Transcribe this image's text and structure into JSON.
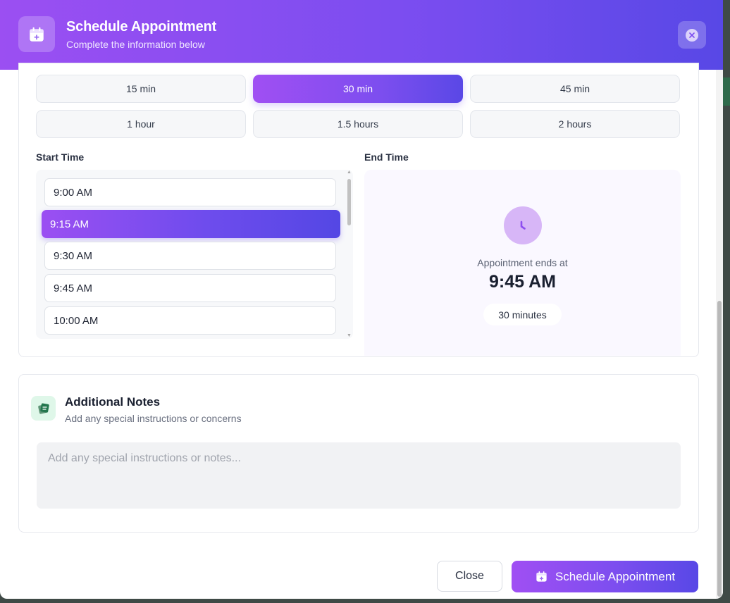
{
  "header": {
    "title": "Schedule Appointment",
    "subtitle": "Complete the information below",
    "icon": "calendar-plus-icon",
    "close_icon": "close-icon"
  },
  "duration": {
    "options": [
      "15 min",
      "30 min",
      "45 min",
      "1 hour",
      "1.5 hours",
      "2 hours"
    ],
    "selected": "30 min"
  },
  "start_time": {
    "label": "Start Time",
    "slots": [
      "9:00 AM",
      "9:15 AM",
      "9:30 AM",
      "9:45 AM",
      "10:00 AM"
    ],
    "selected": "9:15 AM"
  },
  "end_time": {
    "label": "End Time",
    "icon": "clock-icon",
    "ends_label": "Appointment ends at",
    "value": "9:45 AM",
    "duration_pill": "30 minutes"
  },
  "notes": {
    "icon": "notes-icon",
    "title": "Additional Notes",
    "subtitle": "Add any special instructions or concerns",
    "placeholder": "Add any special instructions or notes...",
    "value": ""
  },
  "footer": {
    "close_label": "Close",
    "schedule_label": "Schedule Appointment",
    "schedule_icon": "calendar-plus-icon"
  },
  "colors": {
    "gradient_start": "#9b4ff2",
    "gradient_end": "#5848e6",
    "notes_icon_bg": "#dff7e9",
    "clock_bg": "#d7b6f7"
  }
}
